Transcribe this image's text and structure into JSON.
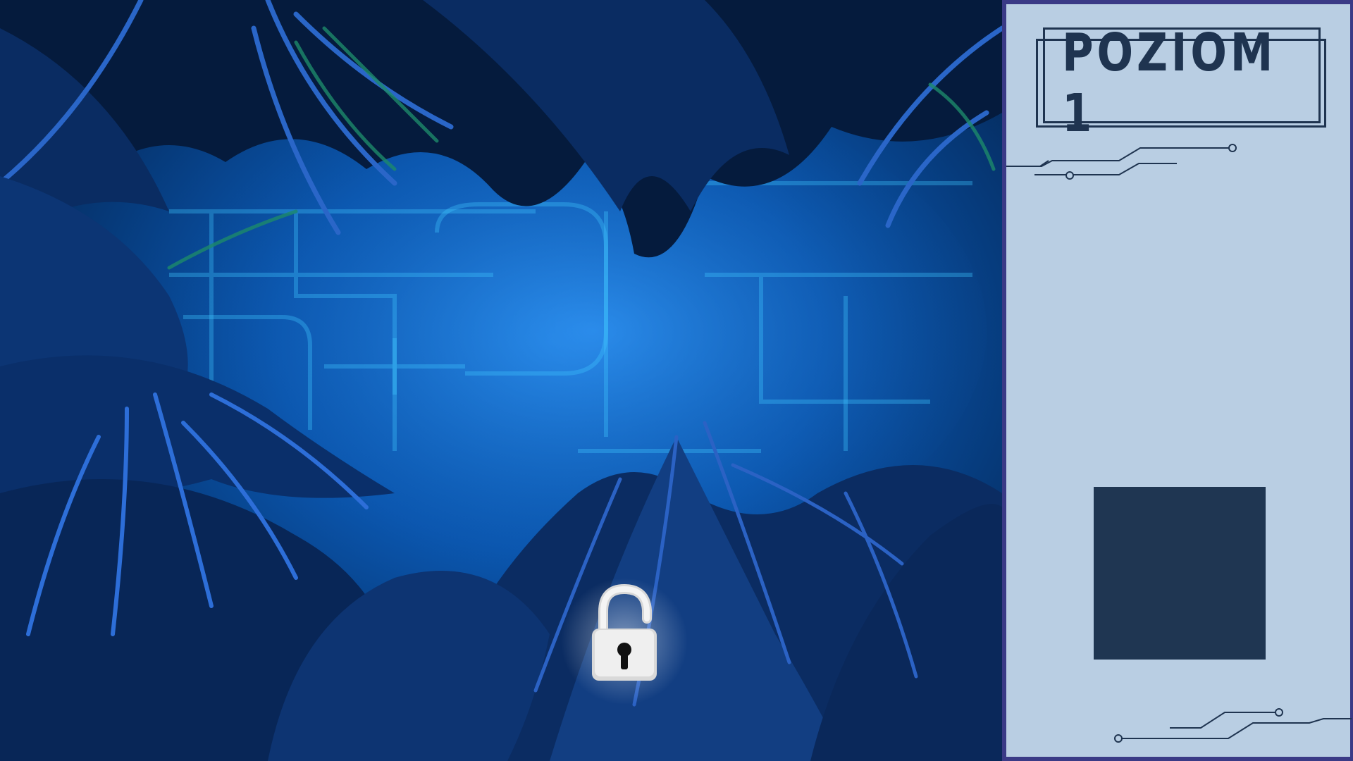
{
  "scene": {
    "name": "jungle-scene",
    "lock_state": "unlocked"
  },
  "panel": {
    "level_title": "POZIOM 1",
    "item_slot_color": "#1f3652"
  },
  "colors": {
    "panel_background": "#b9cee3",
    "panel_border": "#3a3a86",
    "panel_ink": "#1f3450",
    "scene_glow": "#1a78d8"
  }
}
